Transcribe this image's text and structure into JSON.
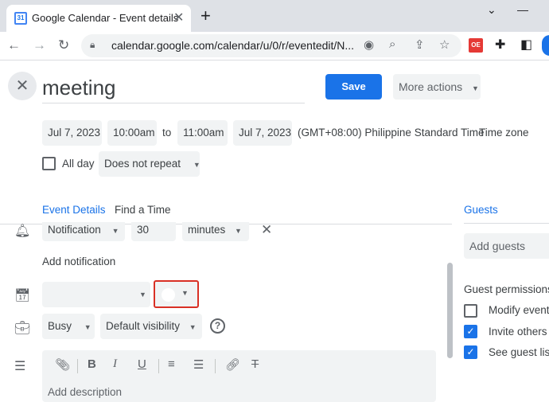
{
  "browser": {
    "tab_title": "Google Calendar - Event details",
    "tab_favicon_text": "31",
    "url": "calendar.google.com/calendar/u/0/r/eventedit/N...",
    "extension_badge": "OE"
  },
  "event": {
    "title": "meeting",
    "save_label": "Save",
    "more_actions_label": "More actions",
    "start_date": "Jul 7, 2023",
    "start_time": "10:00am",
    "to_label": "to",
    "end_time": "11:00am",
    "end_date": "Jul 7, 2023",
    "timezone_text": "(GMT+08:00) Philippine Standard Time",
    "timezone_link": "Time zone",
    "all_day_label": "All day",
    "all_day_checked": false,
    "recurrence": "Does not repeat"
  },
  "tabs": {
    "event_details": "Event Details",
    "find_a_time": "Find a Time"
  },
  "notification": {
    "type": "Notification",
    "value": "30",
    "unit": "minutes",
    "add_label": "Add notification"
  },
  "calendar_select": {
    "value": ""
  },
  "availability": {
    "status": "Busy",
    "visibility": "Default visibility"
  },
  "description": {
    "placeholder": "Add description"
  },
  "guests": {
    "title": "Guests",
    "input_placeholder": "Add guests",
    "permissions_label": "Guest permissions",
    "permissions": [
      {
        "label": "Modify event",
        "checked": false
      },
      {
        "label": "Invite others",
        "checked": true
      },
      {
        "label": "See guest list",
        "checked": true
      }
    ]
  },
  "colors": {
    "accent": "#1a73e8",
    "highlight_border": "#d93025"
  }
}
